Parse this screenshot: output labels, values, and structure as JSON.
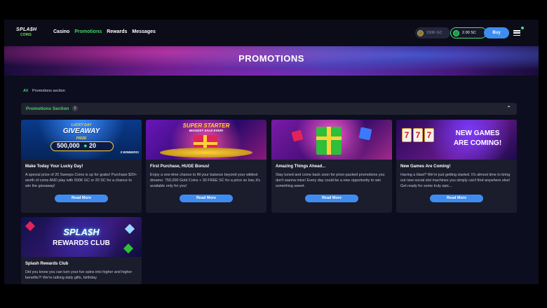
{
  "header": {
    "logo_line1": "SPLA$H",
    "logo_line2": "COINS",
    "nav": [
      "Casino",
      "Promotions",
      "Rewards",
      "Messages"
    ],
    "gc_balance": "150K GC",
    "sc_balance": "2.00 SC",
    "buy_label": "Buy"
  },
  "banner": {
    "title": "PROMOTIONS"
  },
  "breadcrumb": {
    "all": "All",
    "current": "Promotions section"
  },
  "section": {
    "title": "Promotions Section",
    "count": "5"
  },
  "read_more": "Read More",
  "cards": [
    {
      "title": "Make Today Your Lucky Day!",
      "desc": "A special prize of 20 Sweeps Coins is up for grabs! Purchase $20+ worth of coins AND play with 500K GC or 20 SC for a chance to win the giveaway!",
      "art": {
        "top": "LUCKY DAY",
        "main": "GIVEAWAY",
        "prize": "PRIZE",
        "gc": "500,000",
        "sc": "20",
        "winners": "3 WINNERS!"
      }
    },
    {
      "title": "First Purchase, HUGE Bonus!",
      "desc": "Enjoy a one-time chance to fill your balance beyond your wildest dreams: 750,000 Gold Coins + 30 FREE SC for a price so low, it's available only for you!",
      "art": {
        "main": "SUPER STARTER",
        "sub": "BIGGEST SALE EVER!"
      }
    },
    {
      "title": "Amazing Things Ahead...",
      "desc": "Stay tuned and come back soon for prize-packed promotions you don't wanna miss! Every day could be a new opportunity to win something sweet."
    },
    {
      "title": "New Games Are Coming!",
      "desc": "Having a blast? We're just getting started. It's almost time to bring out new social slot machines you simply can't find anywhere else! Get ready for some truly epic...",
      "art": {
        "line1": "NEW GAMES",
        "line2": "ARE COMING!",
        "slot": "7"
      }
    },
    {
      "title": "Splash Rewards Club",
      "desc": "Did you know you can turn your fun spins into higher and higher benefits?! We're talking daily gifts, birthday",
      "art": {
        "line1": "SPLA$H",
        "line2": "REWARDS CLUB"
      }
    }
  ],
  "colors": {
    "accent_green": "#46d36a",
    "button_blue": "#3f8cf0",
    "card_bg": "#1b1c2c"
  }
}
